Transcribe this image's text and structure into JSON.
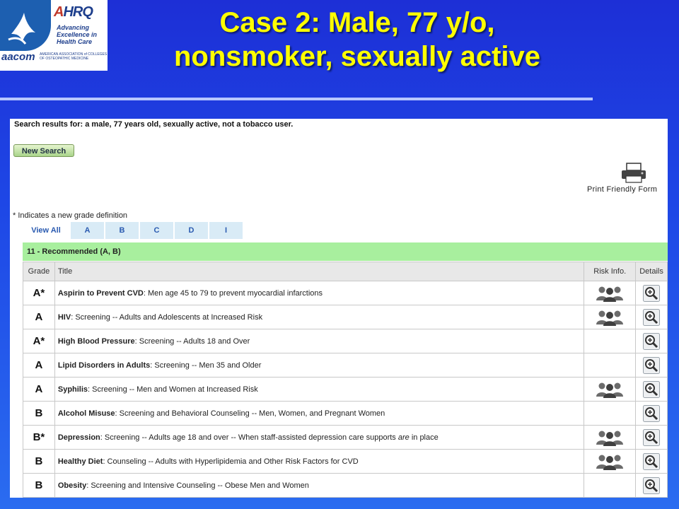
{
  "slide_title": {
    "line1": "Case 2: Male, 77 y/o,",
    "line2": "nonsmoker, sexually active"
  },
  "logos": {
    "ahrq_mark_a": "A",
    "ahrq_mark_rest": "HRQ",
    "ahrq_tagline_1": "Advancing",
    "ahrq_tagline_2": "Excellence in",
    "ahrq_tagline_3": "Health Care",
    "aacom_mark": "aacom",
    "aacom_sub": "AMERICAN ASSOCIATION of COLLEGES OF OSTEOPATHIC MEDICINE"
  },
  "search_results_label": "Search results for: a male, 77 years old, sexually active, not a tobacco user.",
  "new_search_label": "New Search",
  "print_label": "Print Friendly Form",
  "note": "* Indicates a new grade definition",
  "tabs": [
    "View All",
    "A",
    "B",
    "C",
    "D",
    "I"
  ],
  "group_header": "11 - Recommended (A, B)",
  "columns": {
    "grade": "Grade",
    "title": "Title",
    "risk": "Risk Info.",
    "details": "Details"
  },
  "rows": [
    {
      "grade": "A*",
      "name": "Aspirin to Prevent CVD",
      "desc_pre": ": Men age 45 to 79 to prevent myocardial infarctions",
      "desc_em": "",
      "desc_post": "",
      "risk": true
    },
    {
      "grade": "A",
      "name": "HIV",
      "desc_pre": ": Screening -- Adults and Adolescents at Increased Risk",
      "desc_em": "",
      "desc_post": "",
      "risk": true
    },
    {
      "grade": "A*",
      "name": "High Blood Pressure",
      "desc_pre": ": Screening -- Adults 18 and Over",
      "desc_em": "",
      "desc_post": "",
      "risk": false
    },
    {
      "grade": "A",
      "name": "Lipid Disorders in Adults",
      "desc_pre": ": Screening -- Men 35 and Older",
      "desc_em": "",
      "desc_post": "",
      "risk": false
    },
    {
      "grade": "A",
      "name": "Syphilis",
      "desc_pre": ": Screening -- Men and Women at Increased Risk",
      "desc_em": "",
      "desc_post": "",
      "risk": true
    },
    {
      "grade": "B",
      "name": "Alcohol Misuse",
      "desc_pre": ": Screening and Behavioral Counseling -- Men, Women, and Pregnant Women",
      "desc_em": "",
      "desc_post": "",
      "risk": false
    },
    {
      "grade": "B*",
      "name": "Depression",
      "desc_pre": ": Screening -- Adults age 18 and over -- When staff-assisted depression care supports ",
      "desc_em": "are",
      "desc_post": " in place",
      "risk": true
    },
    {
      "grade": "B",
      "name": "Healthy Diet",
      "desc_pre": ": Counseling -- Adults with Hyperlipidemia and Other Risk Factors for CVD",
      "desc_em": "",
      "desc_post": "",
      "risk": true
    },
    {
      "grade": "B",
      "name": "Obesity",
      "desc_pre": ": Screening and Intensive Counseling -- Obese Men and Women",
      "desc_em": "",
      "desc_post": "",
      "risk": false
    }
  ],
  "icons": {
    "risk": "people-group-icon",
    "details": "magnifier-icon",
    "print": "printer-icon"
  },
  "colors": {
    "title": "#ffff00",
    "group_header_bg": "#a8ef9e",
    "tab_bg": "#d9ebf6",
    "tab_text": "#2a5ab0"
  }
}
